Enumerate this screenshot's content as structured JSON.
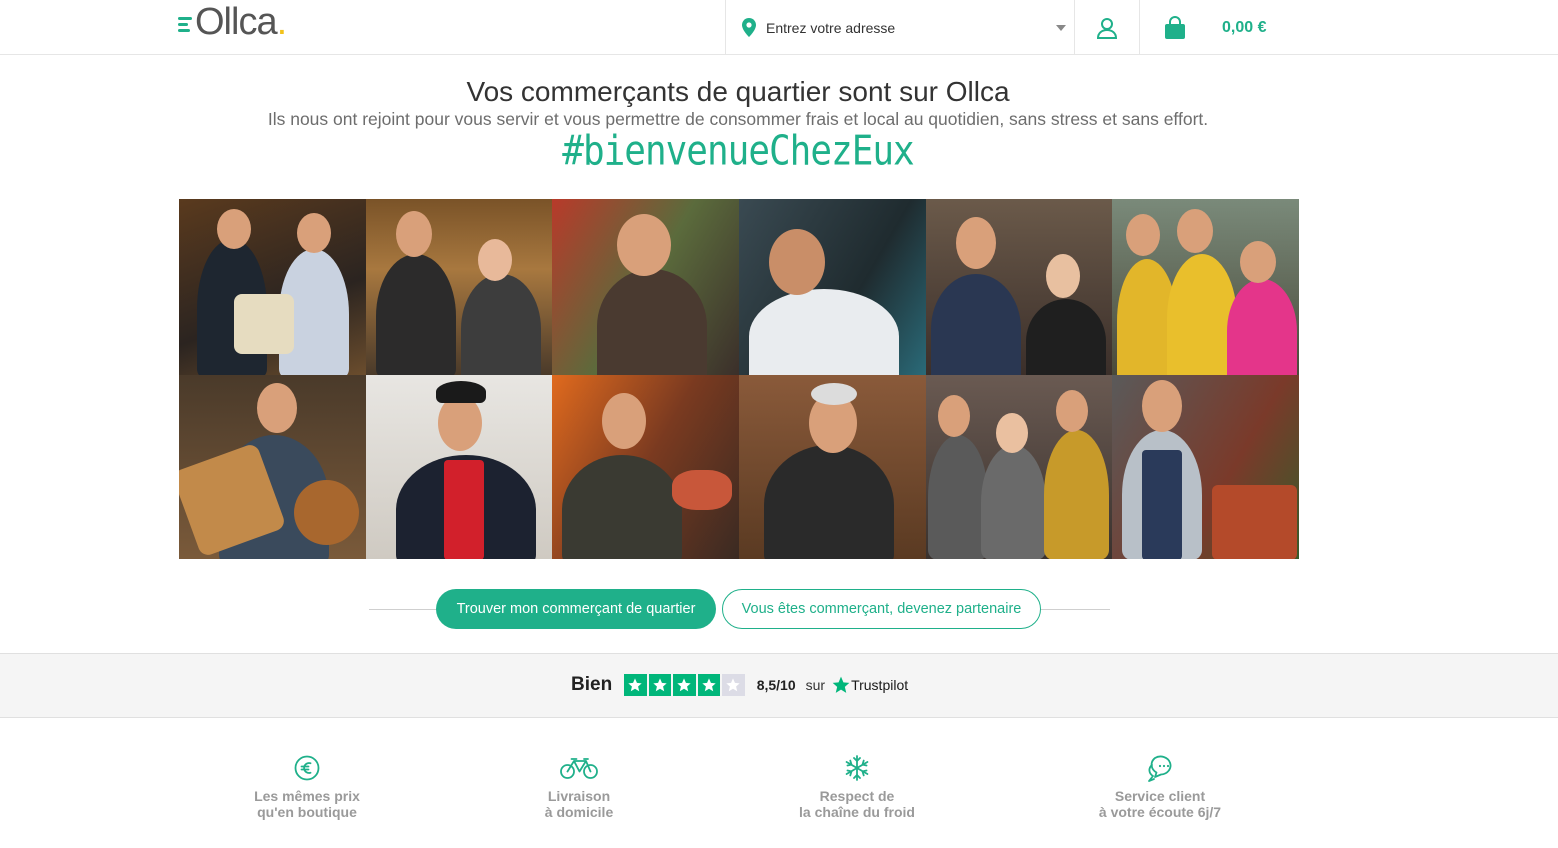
{
  "header": {
    "logo_text": "Ollca",
    "logo_dot": ".",
    "address_placeholder": "Entrez votre adresse",
    "cart_total": "0,00 €",
    "brand_color": "#1fb08a"
  },
  "hero": {
    "title": "Vos commerçants de quartier sont sur Ollca",
    "subtitle": "Ils nous ont rejoint pour vous servir et vous permettre de consommer frais et local au quotidien, sans stress et sans effort.",
    "hashtag": "#bienvenueChezEux"
  },
  "photos": [
    {
      "name": "cheese-shop"
    },
    {
      "name": "deli-shop"
    },
    {
      "name": "butcher"
    },
    {
      "name": "fishmonger"
    },
    {
      "name": "wine-shop"
    },
    {
      "name": "market-team"
    },
    {
      "name": "bakery"
    },
    {
      "name": "pastry-chef"
    },
    {
      "name": "seafood"
    },
    {
      "name": "wine-cellar"
    },
    {
      "name": "cafe-team"
    },
    {
      "name": "greengrocer"
    }
  ],
  "cta": {
    "primary_label": "Trouver mon commerçant de quartier",
    "secondary_label": "Vous êtes commerçant, devenez partenaire"
  },
  "trustpilot": {
    "label": "Bien",
    "stars_filled": 4,
    "stars_total": 5,
    "score": "8,5/10",
    "sur": "sur",
    "brand": "Trustpilot"
  },
  "features": [
    {
      "icon": "euro-icon",
      "line1": "Les mêmes prix",
      "line2": "qu'en boutique"
    },
    {
      "icon": "bicycle-icon",
      "line1": "Livraison",
      "line2": "à domicile"
    },
    {
      "icon": "snowflake-icon",
      "line1": "Respect de",
      "line2": "la chaîne du froid"
    },
    {
      "icon": "chat-icon",
      "line1": "Service client",
      "line2": "à votre écoute 6j/7"
    }
  ]
}
